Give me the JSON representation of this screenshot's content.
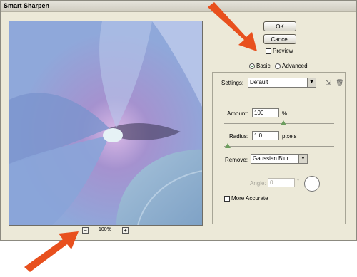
{
  "window": {
    "title": "Smart Sharpen"
  },
  "buttons": {
    "ok": "OK",
    "cancel": "Cancel"
  },
  "preview": {
    "label": "Preview",
    "checked": false
  },
  "mode": {
    "basic": "Basic",
    "advanced": "Advanced",
    "selected": "Basic"
  },
  "settings": {
    "label": "Settings:",
    "value": "Default"
  },
  "amount": {
    "label": "Amount:",
    "value": "100",
    "unit": "%"
  },
  "radius": {
    "label": "Radius:",
    "value": "1.0",
    "unit": "pixels"
  },
  "remove": {
    "label": "Remove:",
    "value": "Gaussian Blur"
  },
  "angle": {
    "label": "Angle:",
    "value": "0",
    "unit": "°"
  },
  "more_accurate": {
    "label": "More Accurate",
    "checked": false
  },
  "zoom": {
    "level": "100%",
    "minus": "−",
    "plus": "+"
  },
  "icons": [
    "save-settings-icon",
    "delete-settings-icon",
    "arrow-icon"
  ],
  "colors": {
    "arrow": "#e8501e",
    "dialog_bg": "#ece9d8"
  }
}
